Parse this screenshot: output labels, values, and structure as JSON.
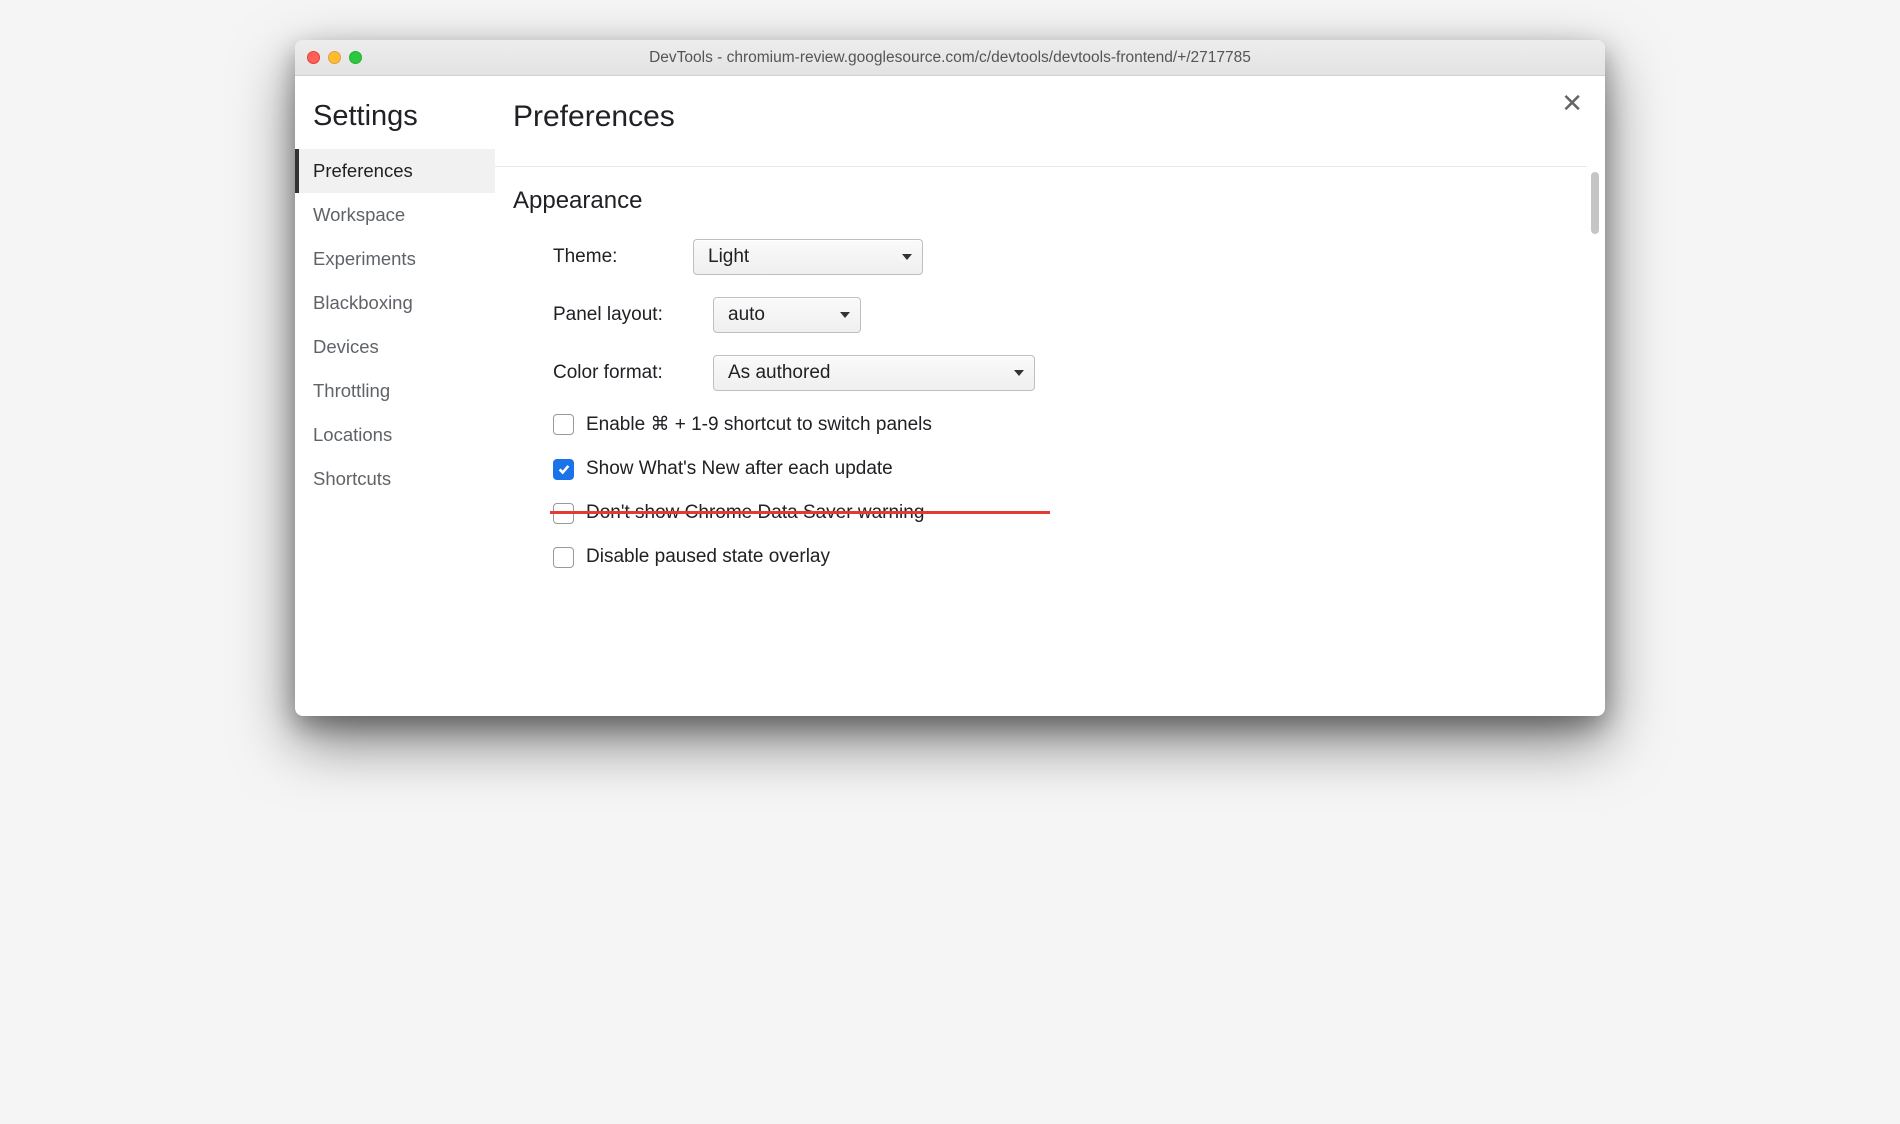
{
  "window": {
    "title": "DevTools - chromium-review.googlesource.com/c/devtools/devtools-frontend/+/2717785"
  },
  "sidebar": {
    "title": "Settings",
    "items": [
      {
        "label": "Preferences",
        "active": true
      },
      {
        "label": "Workspace",
        "active": false
      },
      {
        "label": "Experiments",
        "active": false
      },
      {
        "label": "Blackboxing",
        "active": false
      },
      {
        "label": "Devices",
        "active": false
      },
      {
        "label": "Throttling",
        "active": false
      },
      {
        "label": "Locations",
        "active": false
      },
      {
        "label": "Shortcuts",
        "active": false
      }
    ]
  },
  "main": {
    "title": "Preferences",
    "section_title": "Appearance",
    "theme": {
      "label": "Theme:",
      "value": "Light"
    },
    "panel_layout": {
      "label": "Panel layout:",
      "value": "auto"
    },
    "color_format": {
      "label": "Color format:",
      "value": "As authored"
    },
    "checkboxes": [
      {
        "label": "Enable ⌘ + 1-9 shortcut to switch panels",
        "checked": false,
        "struck": false
      },
      {
        "label": "Show What's New after each update",
        "checked": true,
        "struck": false
      },
      {
        "label": "Don't show Chrome Data Saver warning",
        "checked": false,
        "struck": true
      },
      {
        "label": "Disable paused state overlay",
        "checked": false,
        "struck": false
      }
    ]
  }
}
